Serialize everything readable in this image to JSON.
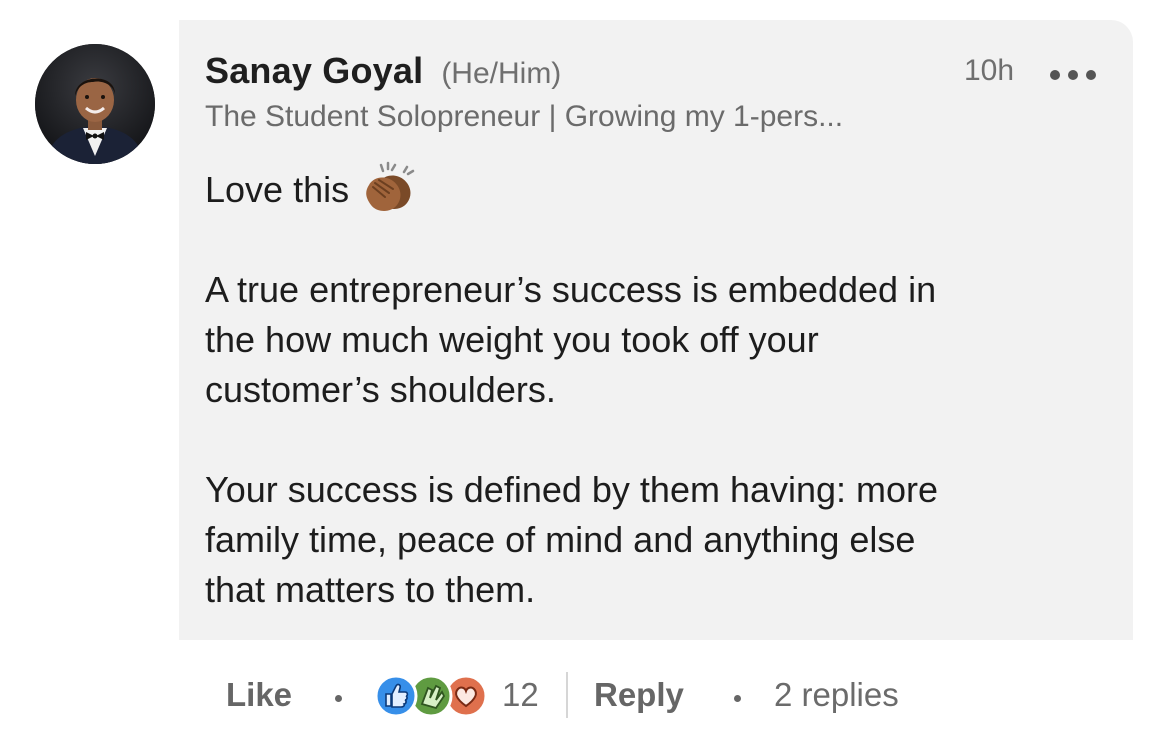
{
  "comment": {
    "author_name": "Sanay Goyal",
    "pronouns": "(He/Him)",
    "headline": "The Student Solopreneur | Growing my 1-pers...",
    "timestamp": "10h",
    "more_icon": "more-horizontal-icon",
    "body": {
      "line1": "Love this",
      "line1_emoji": "clapping-hands-icon",
      "paragraph2": [
        "A true entrepreneur’s success is embedded in",
        "the how much weight you took off your",
        "customer’s shoulders."
      ],
      "paragraph3": [
        "Your success is defined by them having: more",
        "family time, peace of mind and anything else",
        "that matters to them."
      ]
    }
  },
  "actions": {
    "like_label": "Like",
    "reaction_icons": [
      "like-reaction-icon",
      "celebrate-reaction-icon",
      "love-reaction-icon"
    ],
    "reaction_count": "12",
    "reply_label": "Reply",
    "replies_label": "2 replies"
  },
  "colors": {
    "bubble_bg": "#f2f2f2",
    "like_blue": "#378fe9",
    "celebrate_green": "#5f9b41",
    "love_red": "#df704d",
    "secondary_text": "#6b6b6b"
  }
}
